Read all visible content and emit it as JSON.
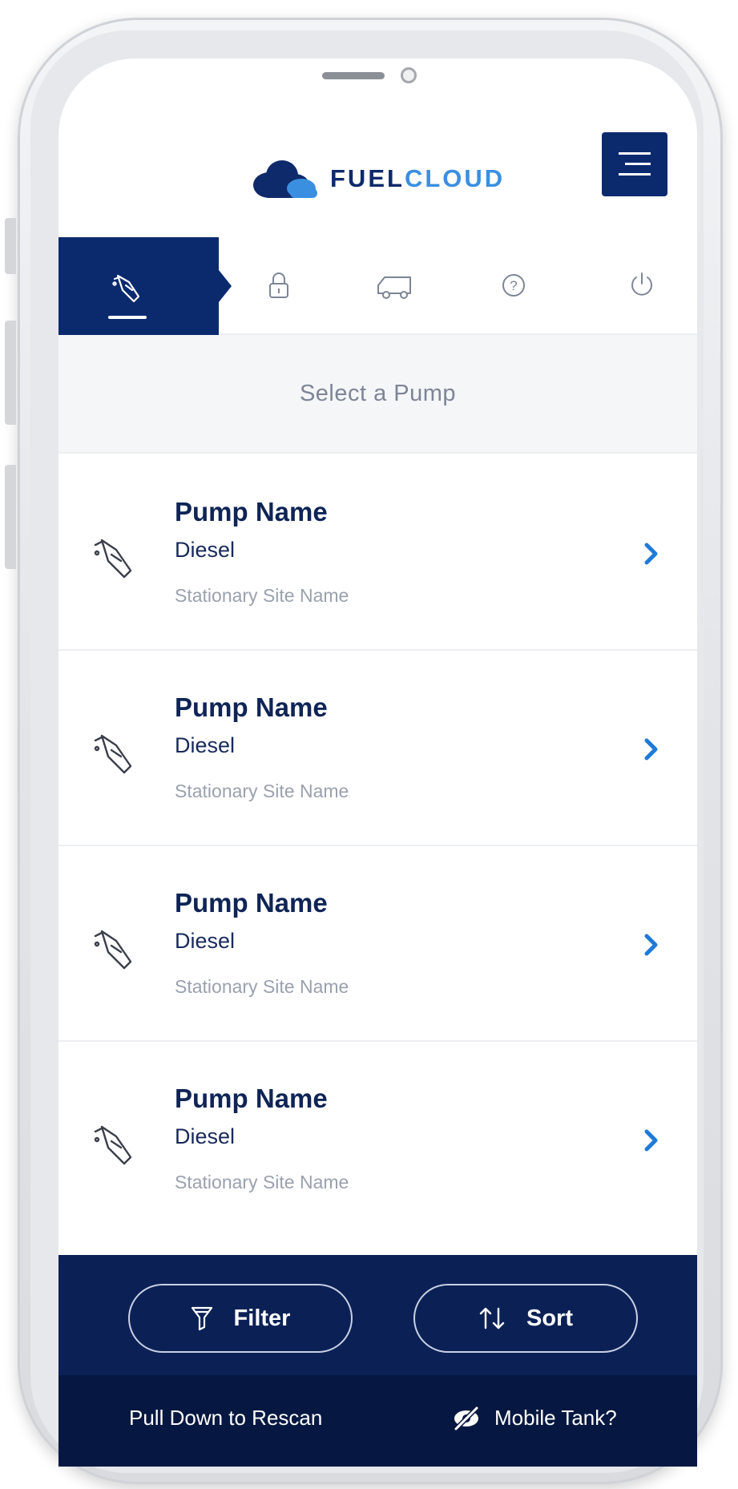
{
  "header": {
    "brand_main": "FUEL",
    "brand_accent": "CLOUD",
    "menu_icon": "hamburger-icon"
  },
  "tabs": [
    {
      "icon": "fuel-nozzle-icon",
      "active": true
    },
    {
      "icon": "lock-icon",
      "active": false
    },
    {
      "icon": "truck-icon",
      "active": false
    },
    {
      "icon": "help-icon",
      "active": false
    },
    {
      "icon": "power-icon",
      "active": false
    }
  ],
  "section": {
    "title": "Select a Pump"
  },
  "pumps": [
    {
      "name": "Pump Name",
      "fuel": "Diesel",
      "site": "Stationary Site Name"
    },
    {
      "name": "Pump Name",
      "fuel": "Diesel",
      "site": "Stationary Site Name"
    },
    {
      "name": "Pump Name",
      "fuel": "Diesel",
      "site": "Stationary Site Name"
    },
    {
      "name": "Pump Name",
      "fuel": "Diesel",
      "site": "Stationary Site Name"
    }
  ],
  "actions": {
    "filter_label": "Filter",
    "sort_label": "Sort"
  },
  "footer": {
    "rescan_label": "Pull Down to Rescan",
    "mobile_tank_label": "Mobile Tank?"
  },
  "colors": {
    "navy": "#0b2a6e",
    "accent_blue": "#3a8fe0",
    "chevron_blue": "#1f7ad8",
    "muted_text": "#9aa1ad"
  }
}
